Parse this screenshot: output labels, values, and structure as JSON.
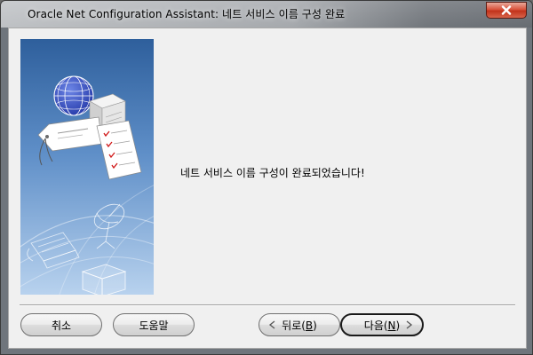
{
  "window": {
    "title": "Oracle Net Configuration Assistant: 네트 서비스 이름 구성 완료"
  },
  "main": {
    "message": "네트 서비스 이름 구성이 완료되었습니다!"
  },
  "buttons": {
    "cancel": "취소",
    "help": "도움말",
    "back_prefix": "뒤로(",
    "back_mnemonic": "B",
    "back_suffix": ")",
    "next_prefix": "다음(",
    "next_mnemonic": "N",
    "next_suffix": ")"
  },
  "icons": {
    "close": "close-icon",
    "back": "chevron-left-icon",
    "next": "chevron-right-icon"
  },
  "colors": {
    "close_button": "#c2331b",
    "illustration_top": "#2e5f9c",
    "illustration_bottom": "#b8d2ee"
  }
}
